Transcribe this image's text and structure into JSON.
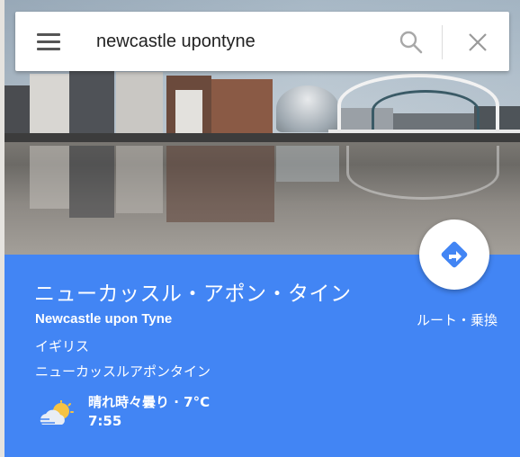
{
  "search": {
    "query": "newcastle upontyne",
    "menu_icon": "hamburger-menu-icon",
    "search_icon": "magnifier-icon",
    "clear_icon": "close-icon"
  },
  "place": {
    "title": "ニューカッスル・アポン・タイン",
    "subtitle": "Newcastle upon Tyne",
    "country": "イギリス",
    "alt_name": "ニューカッスルアポンタイン"
  },
  "weather": {
    "icon": "partly-cloudy-icon",
    "summary": "晴れ時々曇り · 7°C",
    "time": "7:55"
  },
  "directions": {
    "icon": "directions-arrow-icon",
    "label": "ルート・乗換"
  },
  "colors": {
    "card_blue": "#4285f4",
    "directions_icon": "#4285f4",
    "sun": "#f6c343",
    "cloud": "#e8edf5"
  }
}
